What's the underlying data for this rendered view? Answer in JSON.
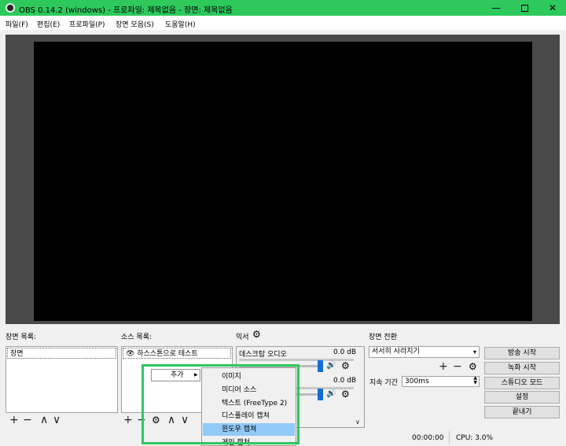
{
  "window": {
    "title": "OBS 0.14.2 (windows) - 프로파일: 제목없음 - 장면: 제목없음",
    "minimize": "—",
    "close": "✕"
  },
  "menu": [
    "파일(F)",
    "편집(E)",
    "프로파일(P)",
    "장면 모음(S)",
    "도움말(H)"
  ],
  "scenes": {
    "title": "장면 목록:",
    "items": [
      "장면"
    ]
  },
  "sources": {
    "title": "소스 목록:",
    "items": [
      "하스스톤으로 테스트"
    ]
  },
  "mixer": {
    "title": "믹서",
    "channels": [
      {
        "name": "데스크탑 오디오",
        "db": "0.0 dB"
      },
      {
        "name": "",
        "db": "0.0 dB"
      }
    ]
  },
  "transitions": {
    "title": "장면 전환",
    "selected": "서서히 사라지기",
    "duration_label": "지속 기간",
    "duration_value": "300ms"
  },
  "controls": {
    "start_stream": "방송 시작",
    "start_record": "녹화 시작",
    "studio_mode": "스튜디오 모드",
    "settings": "설정",
    "exit": "끝내기"
  },
  "status": {
    "time": "00:00:00",
    "cpu": "CPU: 3.0%"
  },
  "context_menu": {
    "add": "추가",
    "submenu": [
      "이미지",
      "미디어 소스",
      "텍스트 (FreeType 2)",
      "디스플레이 캡쳐",
      "윈도우 캡쳐",
      "게임 캡쳐"
    ],
    "highlighted_index": 4
  },
  "icons": {
    "plus": "+",
    "minus": "−",
    "up": "∧",
    "down": "∨",
    "gear": "⚙",
    "eye": "👁",
    "speaker": "🔊",
    "chevron": "▾",
    "arrow_right": "▶",
    "spin_up": "▲",
    "spin_down": "▼"
  },
  "colors": {
    "accent_green": "#2dc95c",
    "slider_blue": "#0a6fd8",
    "menu_highlight": "#91c9f7"
  }
}
